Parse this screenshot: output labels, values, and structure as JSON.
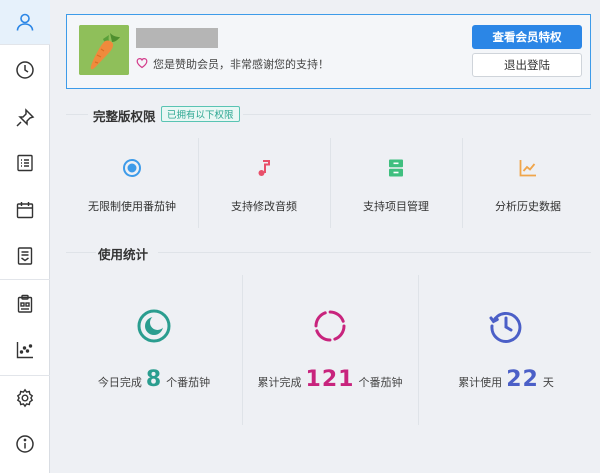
{
  "sidebar": {
    "items": [
      {
        "name": "user-icon",
        "active": true
      },
      {
        "name": "clock-icon"
      },
      {
        "name": "pin-icon"
      },
      {
        "name": "list-icon"
      },
      {
        "name": "calendar-icon"
      },
      {
        "name": "document-icon"
      },
      {
        "name": "clipboard-icon"
      },
      {
        "name": "scatter-chart-icon"
      },
      {
        "name": "gear-icon"
      },
      {
        "name": "info-icon"
      }
    ]
  },
  "member": {
    "thanks_text": "您是赞助会员，非常感谢您的支持！",
    "view_benefits_label": "查看会员特权",
    "logout_label": "退出登陆"
  },
  "permissions": {
    "title": "完整版权限",
    "badge": "已拥有以下权限",
    "features": [
      {
        "label": "无限制使用番茄钟",
        "icon": "target-icon",
        "color": "#3d9be9"
      },
      {
        "label": "支持修改音频",
        "icon": "music-note-icon",
        "color": "#e8506a"
      },
      {
        "label": "支持项目管理",
        "icon": "drawer-icon",
        "color": "#3fbf7f"
      },
      {
        "label": "分析历史数据",
        "icon": "trend-chart-icon",
        "color": "#f0a54a"
      }
    ]
  },
  "stats": {
    "title": "使用统计",
    "items": [
      {
        "prefix": "今日完成",
        "value": "8",
        "suffix": "个番茄钟",
        "color": "#2a9d8f",
        "icon": "moon-icon"
      },
      {
        "prefix": "累计完成",
        "value": "121",
        "suffix": "个番茄钟",
        "color": "#c8247d",
        "icon": "dashed-circle-icon"
      },
      {
        "prefix": "累计使用",
        "value": "22",
        "suffix": "天",
        "color": "#4b5fc7",
        "icon": "history-icon"
      }
    ]
  }
}
